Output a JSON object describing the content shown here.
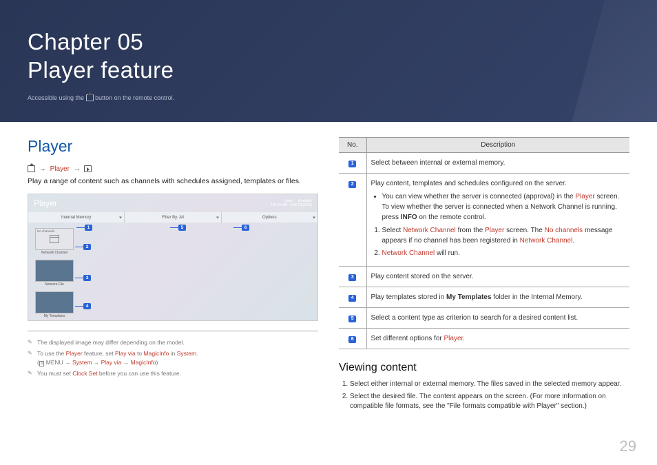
{
  "header": {
    "chapter_line": "Chapter  05",
    "title_line": "Player feature",
    "sub_pre": "Accessible using the ",
    "sub_post": " button on the remote control."
  },
  "left": {
    "heading": "Player",
    "breadcrumb_player": "Player",
    "intro": "Play a range of content such as channels with schedules assigned, templates or files.",
    "screenshot": {
      "title": "Player",
      "used_label": "Used",
      "used_value": "199.33 MB",
      "avail_label": "Available",
      "avail_value": "4.26 GB(95%)",
      "tool1": "Internal Memory",
      "tool2": "Filter By: All",
      "tool3": "Options",
      "tile_nochannels": "No channels",
      "tile_netchannel": "Network Channel",
      "tile_netfile": "Network File",
      "tile_mytemplates": "My Templates"
    },
    "notes": {
      "n1": "The displayed image may differ depending on the model.",
      "n2_pre": "To use the ",
      "n2_mid1": " feature, set ",
      "n2_mid2": " to ",
      "n2_mid3": " in ",
      "n2_post": ".",
      "n2_player": "Player",
      "n2_playvia": "Play via",
      "n2_magic": "MagicInfo",
      "n2_system": "System",
      "n2_path_open": "(",
      "n2_path_menu": "MENU",
      "n2_path_sep": " → ",
      "n2_path_close": ")",
      "n3_pre": "You must set ",
      "n3_link": "Clock Set",
      "n3_post": " before you can use this feature."
    }
  },
  "right": {
    "th_no": "No.",
    "th_desc": "Description",
    "rows": [
      {
        "num": "1",
        "body": "Select between internal or external memory."
      },
      {
        "num": "3",
        "body": "Play content stored on the server."
      },
      {
        "num": "5",
        "body": "Select a content type as criterion to search for a desired content list."
      }
    ],
    "row2": {
      "num": "2",
      "intro": "Play content, templates and schedules configured on the server.",
      "bullet_pre": "You can view whether the server is connected (approval) in the ",
      "bullet_mid": " screen. To view whether the server is connected when a Network Channel is running, press ",
      "bullet_info": "INFO",
      "bullet_post": " on the remote control.",
      "s1_pre": "Select ",
      "s1_a": "Network Channel",
      "s1_mid": " from the ",
      "s1_b": "Player",
      "s1_mid2": " screen. The ",
      "s1_c": "No channels",
      "s1_mid3": " message appears if no channel has been registered in ",
      "s1_d": "Network Channel",
      "s1_post": ".",
      "s2_a": "Network Channel",
      "s2_post": " will run."
    },
    "row4": {
      "num": "4",
      "pre": "Play templates stored in ",
      "bold": "My Templates",
      "post": " folder in the Internal Memory."
    },
    "row6": {
      "num": "6",
      "pre": "Set different options for ",
      "link": "Player",
      "post": "."
    },
    "viewing_heading": "Viewing content",
    "steps": [
      "Select either internal or external memory. The files saved in the selected memory appear.",
      "Select the desired file. The content appears on the screen. (For more information on compatible file formats, see the \"File formats compatible with Player\" section.)"
    ]
  },
  "page_number": "29"
}
